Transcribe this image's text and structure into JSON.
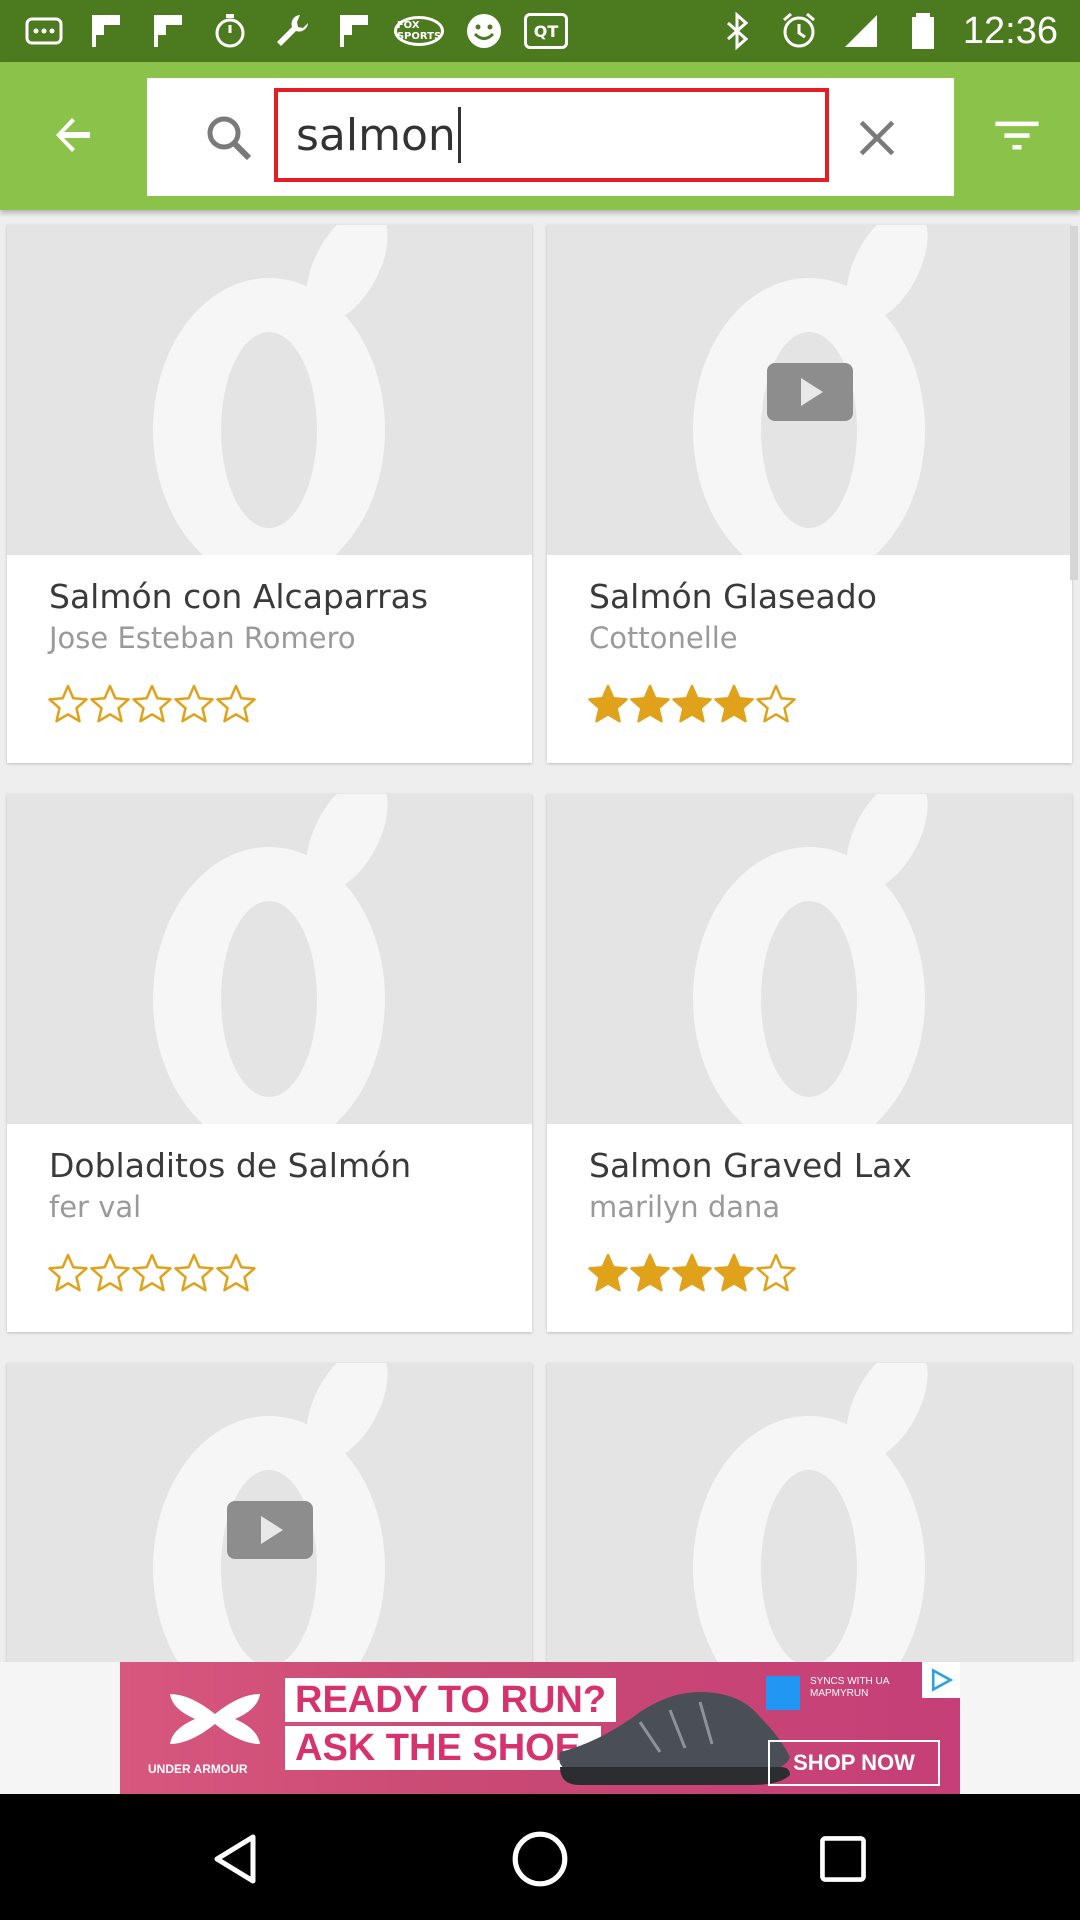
{
  "status_bar": {
    "time": "12:36",
    "left_icons": [
      "more-icon",
      "flipboard-icon",
      "flipboard-icon",
      "stopwatch-icon",
      "wrench-icon",
      "flipboard-icon",
      "fox-sports-icon",
      "smiley-icon",
      "qt-icon"
    ],
    "fox_label": "FOX SPORTS",
    "qt_label": "QT",
    "right_icons": [
      "bluetooth-icon",
      "alarm-icon",
      "signal-icon",
      "battery-icon"
    ]
  },
  "search": {
    "query": "salmon"
  },
  "recipes": [
    {
      "title": "Salmón con Alcaparras",
      "author": "Jose Esteban Romero",
      "rating": 0,
      "max_rating": 5,
      "has_video": false
    },
    {
      "title": "Salmón Glaseado",
      "author": "Cottonelle",
      "rating": 4,
      "max_rating": 5,
      "has_video": true
    },
    {
      "title": "Dobladitos de Salmón",
      "author": "fer val",
      "rating": 0,
      "max_rating": 5,
      "has_video": false
    },
    {
      "title": "Salmon Graved Lax",
      "author": "marilyn dana",
      "rating": 4,
      "max_rating": 5,
      "has_video": false
    },
    {
      "title": "",
      "author": "",
      "rating": null,
      "max_rating": 5,
      "has_video": true
    },
    {
      "title": "",
      "author": "",
      "rating": null,
      "max_rating": 5,
      "has_video": false
    }
  ],
  "ad": {
    "brand": "UNDER ARMOUR",
    "headline_1": "READY TO RUN?",
    "headline_2": "ASK THE SHOE.",
    "badge_text": "SYNCS WITH UA MAPMYRUN",
    "cta": "SHOP NOW"
  },
  "colors": {
    "app_bar": "#8bc34a",
    "status_bar": "#4c7a1e",
    "star_fill": "#e0a21a",
    "search_highlight": "#e31e24"
  }
}
